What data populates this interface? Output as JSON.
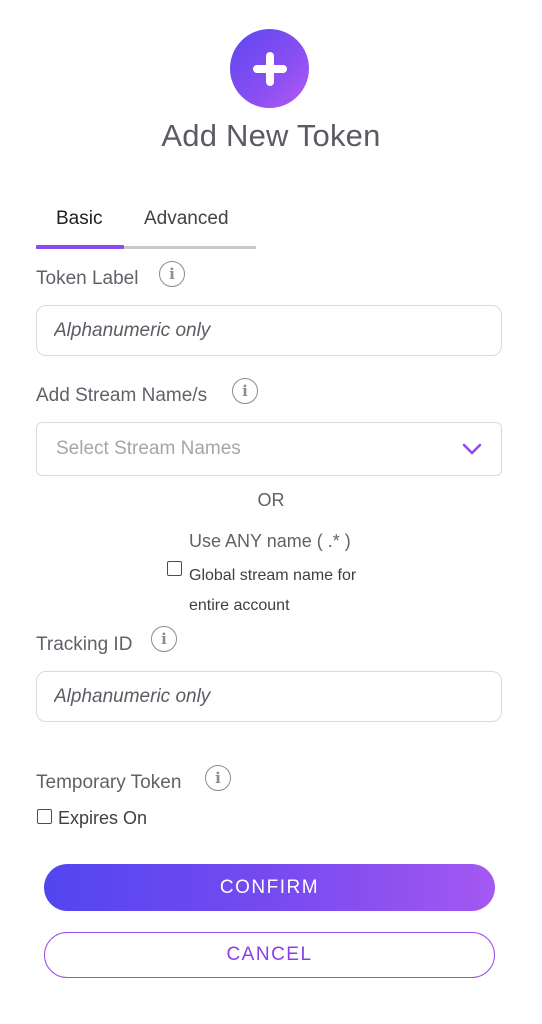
{
  "header": {
    "icon": "plus-icon",
    "title": "Add New Token"
  },
  "tabs": [
    {
      "label": "Basic",
      "active": true
    },
    {
      "label": "Advanced",
      "active": false
    }
  ],
  "token_label": {
    "label": "Token Label",
    "placeholder": "Alphanumeric only",
    "value": ""
  },
  "stream_names": {
    "label": "Add Stream Name/s",
    "placeholder": "Select Stream Names",
    "or_text": "OR",
    "any_name_text": "Use ANY name ( .* )",
    "global_checkbox_label": "Global stream name for entire account",
    "global_checked": false
  },
  "tracking_id": {
    "label": "Tracking ID",
    "placeholder": "Alphanumeric only",
    "value": ""
  },
  "temporary_token": {
    "label": "Temporary Token",
    "expires_label": "Expires On",
    "expires_checked": false
  },
  "actions": {
    "confirm_label": "CONFIRM",
    "cancel_label": "CANCEL"
  },
  "colors": {
    "accent": "#8b4bf0",
    "gradient_start": "#5245ef",
    "gradient_end": "#a458f1"
  }
}
